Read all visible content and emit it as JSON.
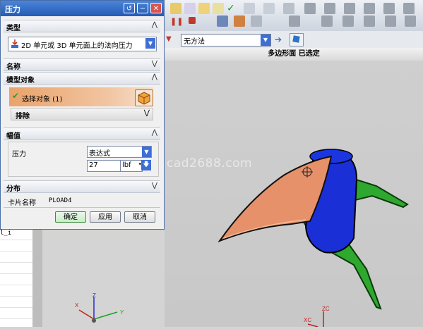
{
  "dialog": {
    "title": "压力",
    "sections": {
      "type": "类型",
      "name": "名称",
      "model_object": "模型对象",
      "magnitude": "幅值",
      "distribution": "分布"
    },
    "type_value": "2D 单元或 3D 单元面上的法向压力",
    "select_object_label": "选择对象 (1)",
    "exclude_label": "排除",
    "pressure_label": "压力",
    "expression_option": "表达式",
    "pressure_value": "27",
    "unit": "lbf",
    "card_name_label": "卡片名称",
    "card_name_value": "PLOAD4",
    "buttons": {
      "ok": "确定",
      "apply": "应用",
      "cancel": "取消"
    }
  },
  "selection_bar": {
    "filter_value": "无方法"
  },
  "status_text": "多边形面 已选定",
  "watermark": "cad2688.com",
  "left_list": {
    "visible_item": "l_i"
  },
  "axes": {
    "x": "X",
    "y": "Y",
    "z": "Z",
    "zc": "ZC",
    "xc": "XC"
  },
  "colors": {
    "title_bar": "#2e66c0",
    "dropdown_button": "#3d6fd6",
    "selected_face": "#e6916a",
    "part_blue": "#1a2fd6",
    "part_green": "#2ea82e"
  }
}
